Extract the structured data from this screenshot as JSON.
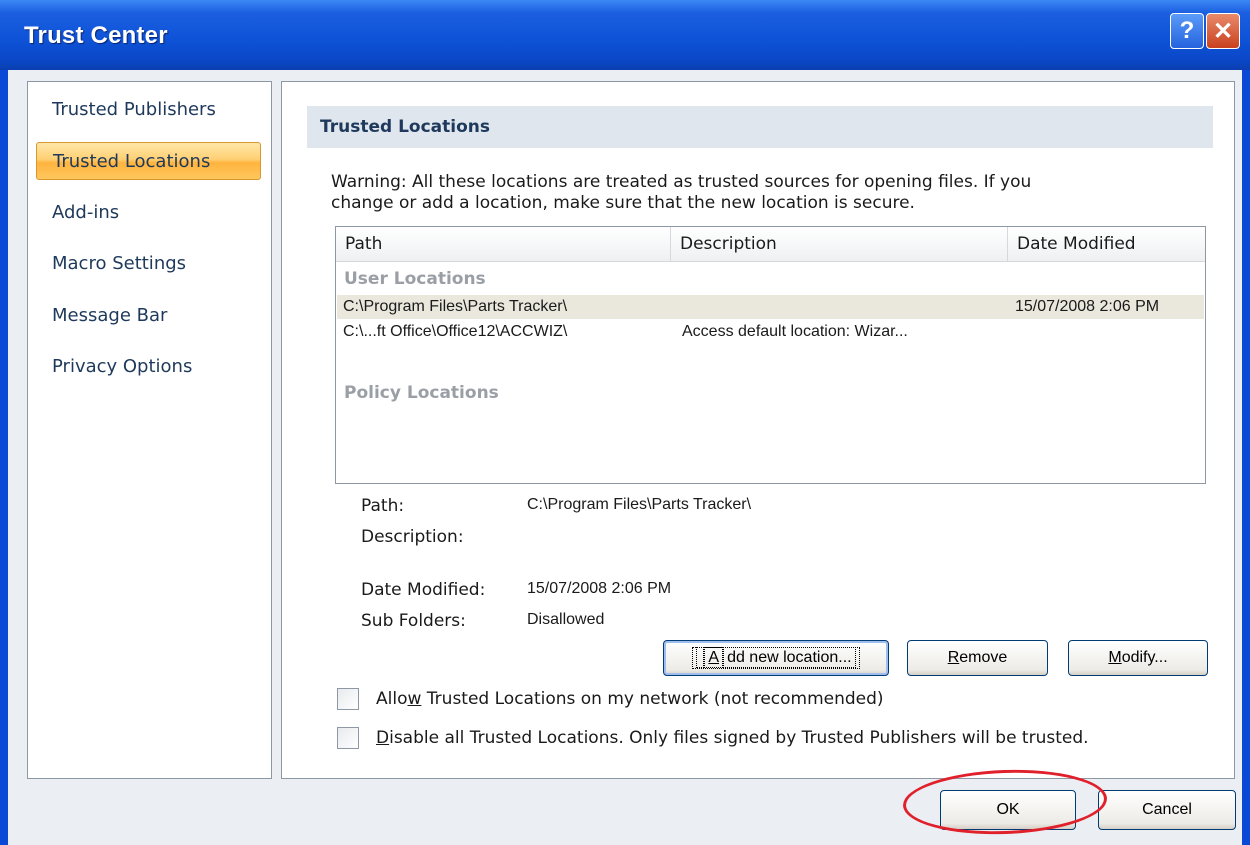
{
  "window": {
    "title": "Trust Center"
  },
  "titlebar_buttons": {
    "help": "?",
    "close": "✕"
  },
  "nav": {
    "items": [
      {
        "label": "Trusted Publishers"
      },
      {
        "label": "Trusted Locations",
        "selected": true
      },
      {
        "label": "Add-ins"
      },
      {
        "label": "Macro Settings"
      },
      {
        "label": "Message Bar"
      },
      {
        "label": "Privacy Options"
      }
    ]
  },
  "section": {
    "title": "Trusted Locations",
    "warning_line1": "Warning: All these locations are treated as trusted sources for opening files.  If you",
    "warning_line2": "change or add a location, make sure that the new location is secure."
  },
  "list": {
    "columns": [
      "Path",
      "Description",
      "Date Modified"
    ],
    "user_group": "User Locations",
    "rows": [
      {
        "path": "C:\\Program Files\\Parts Tracker\\",
        "description": "",
        "date": "15/07/2008 2:06 PM",
        "selected": true
      },
      {
        "path": "C:\\...ft Office\\Office12\\ACCWIZ\\",
        "description": "Access default location: Wizar...",
        "date": ""
      }
    ],
    "policy_group": "Policy Locations"
  },
  "details": {
    "path_label": "Path:",
    "path_value": "C:\\Program Files\\Parts Tracker\\",
    "description_label": "Description:",
    "description_value": "",
    "date_label": "Date Modified:",
    "date_value": "15/07/2008 2:06 PM",
    "subfolders_label": "Sub Folders:",
    "subfolders_value": "Disallowed"
  },
  "buttons": {
    "add_pre": "",
    "add_key": "A",
    "add_post": "dd new location...",
    "remove_pre": "",
    "remove_key": "R",
    "remove_post": "emove",
    "modify_pre": "",
    "modify_key": "M",
    "modify_post": "odify...",
    "ok": "OK",
    "cancel": "Cancel"
  },
  "options": {
    "allow_network_pre": "Allo",
    "allow_network_key": "w",
    "allow_network_post": " Trusted Locations on my network (not recommended)",
    "allow_network_checked": false,
    "disable_all_pre": "",
    "disable_all_key": "D",
    "disable_all_post": "isable all Trusted Locations. Only files signed by Trusted Publishers will be trusted.",
    "disable_all_checked": false
  },
  "colors": {
    "titlebar": "#0e53d8",
    "selection": "#ffc75e",
    "annotation": "#e0202a"
  }
}
